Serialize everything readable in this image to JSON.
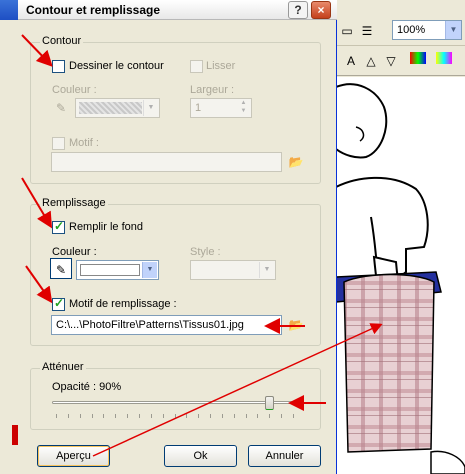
{
  "background": {
    "zoom": "100%"
  },
  "dialog": {
    "title": "Contour et remplissage",
    "contour": {
      "group_label": "Contour",
      "draw_outline_label": "Dessiner le contour",
      "draw_outline_checked": false,
      "smooth_label": "Lisser",
      "color_label": "Couleur :",
      "width_label": "Largeur :",
      "width_value": "1",
      "pattern_label": "Motif :"
    },
    "fill": {
      "group_label": "Remplissage",
      "fill_background_label": "Remplir le fond",
      "fill_background_checked": true,
      "color_label": "Couleur :",
      "style_label": "Style :",
      "fill_pattern_label": "Motif de remplissage :",
      "fill_pattern_checked": true,
      "pattern_path": "C:\\...\\PhotoFiltre\\Patterns\\Tissus01.jpg"
    },
    "attenuate": {
      "group_label": "Atténuer",
      "opacity_label": "Opacité : 90%",
      "opacity_value": 0.9
    },
    "buttons": {
      "preview": "Aperçu",
      "ok": "Ok",
      "cancel": "Annuler"
    },
    "colors": {
      "annotation_arrow": "#e00000",
      "selection_accent": "#f7c35c"
    }
  }
}
